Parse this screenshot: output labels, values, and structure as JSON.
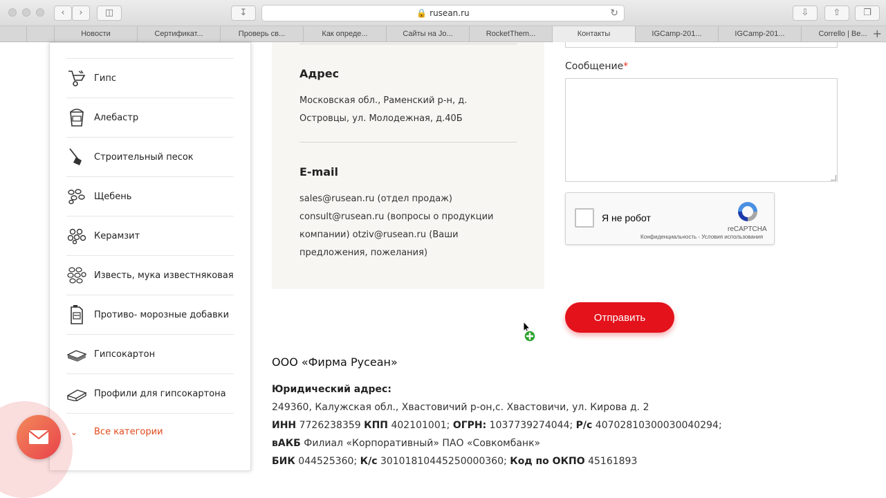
{
  "browser": {
    "url": "rusean.ru",
    "tabs": [
      "Новости",
      "Сертификат...",
      "Проверь св...",
      "Как опреде...",
      "Сайты на Jo...",
      "RocketThem...",
      "Контакты",
      "IGCamp-201...",
      "IGCamp-201...",
      "Corrello | Be..."
    ],
    "active_tab": 6,
    "new_tab_symbol": "+"
  },
  "sidebar": {
    "items": [
      {
        "label": "Гипс",
        "icon": "wheelbarrow-icon"
      },
      {
        "label": "Алебастр",
        "icon": "bucket-icon"
      },
      {
        "label": "Строительный песок",
        "icon": "shovel-icon"
      },
      {
        "label": "Щебень",
        "icon": "gravel-icon"
      },
      {
        "label": "Керамзит",
        "icon": "clay-pebbles-icon"
      },
      {
        "label": "Известь, мука известняковая",
        "icon": "lime-icon"
      },
      {
        "label": "Противо- морозные добавки",
        "icon": "canister-icon"
      },
      {
        "label": "Гипсокартон",
        "icon": "drywall-icon"
      },
      {
        "label": "Профили для гипсокартона",
        "icon": "profile-icon"
      }
    ],
    "all_categories": "Все категории"
  },
  "contacts": {
    "address_heading": "Адрес",
    "address_text": "Московская обл., Раменский р-н, д. Островцы, ул. Молодежная, д.40Б",
    "email_heading": "E-mail",
    "email_text": "sales@rusean.ru (отдел продаж) consult@rusean.ru (вопросы о продукции компании) otziv@rusean.ru (Ваши предложения, пожелания)"
  },
  "form": {
    "message_label": "Сообщение",
    "required_mark": "*",
    "message_value": "",
    "captcha_label": "Я не робот",
    "captcha_brand": "reCAPTCHA",
    "captcha_links": "Конфиденциальность - Условия использования",
    "send_label": "Отправить"
  },
  "company": {
    "name": "ООО «Фирма Русеан»",
    "legal_address_label": "Юридический адрес:",
    "legal_address": "249360, Калужская обл., Хвастовичий р-он,с. Хвастовичи, ул. Кирова д. 2",
    "inn_label": "ИНН",
    "inn": " 7726238359 ",
    "kpp_label": "КПП",
    "kpp": " 402101001; ",
    "ogrn_label": "ОГРН:",
    "ogrn": " 1037739274044; ",
    "rs_label": "Р/с",
    "rs": " 40702810300030040294;",
    "bank_label": "вАКБ",
    "bank": " Филиал «Корпоративный» ПАО «Совкомбанк»",
    "bik_label": "БИК",
    "bik": " 044525360; ",
    "ks_label": "К/с",
    "ks": " 30101810445250000360; ",
    "okpo_label": "Код по ОКПО",
    "okpo": " 45161893"
  },
  "colors": {
    "accent": "#e3121b",
    "link_orange": "#e0491a",
    "box_bg": "#f7f6f3"
  }
}
